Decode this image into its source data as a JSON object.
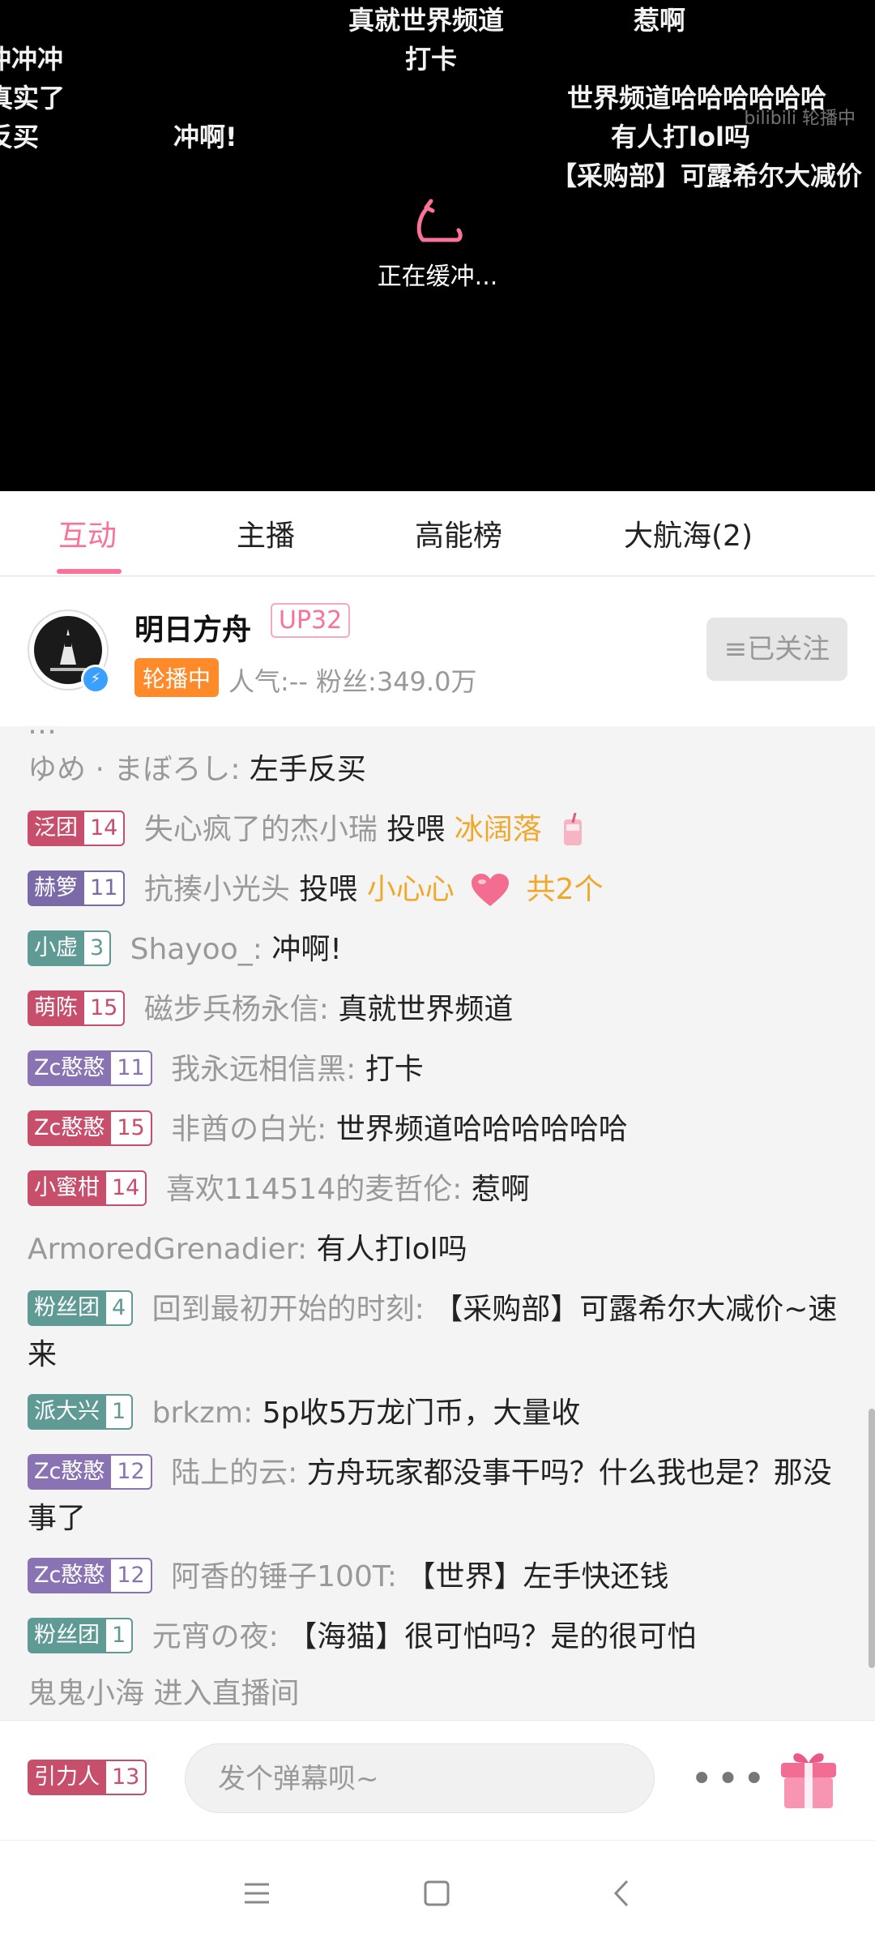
{
  "player": {
    "danmaku": [
      "真就世界频道",
      "惹啊",
      "冲冲冲",
      "打卡",
      "真实了",
      "世界频道哈哈哈哈哈哈",
      "反买",
      "冲啊!",
      "有人打lol吗",
      "【采购部】可露希尔大减价"
    ],
    "watermark": "bilibili 轮播中",
    "buffering_text": "正在缓冲..."
  },
  "tabs": [
    "互动",
    "主播",
    "高能榜",
    "大航海(2)"
  ],
  "streamer": {
    "name": "明日方舟",
    "up_level": "UP32",
    "status_badge": "轮播中",
    "stats": "人气:--  粉丝:349.0万",
    "follow_label": "≡已关注"
  },
  "chat": {
    "partial_top": "…",
    "lines": [
      {
        "user": "ゆめ · まぼろし:",
        "text": "左手反买"
      },
      {
        "medal": {
          "name": "泛团",
          "level": "14",
          "color": "#c74f6c"
        },
        "user": "失心疯了的杰小瑞",
        "action": "投喂",
        "gift": "冰阔落"
      },
      {
        "medal": {
          "name": "赫箩",
          "level": "11",
          "color": "#7a6aa8"
        },
        "user": "抗揍小光头",
        "action": "投喂",
        "gift": "小心心",
        "count": "共2个"
      },
      {
        "medal": {
          "name": "小虚",
          "level": "3",
          "color": "#5f9a95"
        },
        "user": "Shayoo_:",
        "text": "冲啊!"
      },
      {
        "medal": {
          "name": "萌陈",
          "level": "15",
          "color": "#c74f6c"
        },
        "user": "磁步兵杨永信:",
        "text": "真就世界频道"
      },
      {
        "medal": {
          "name": "Zc憨憨",
          "level": "11",
          "color": "#8a73b3"
        },
        "user": "我永远相信黑:",
        "text": "打卡"
      },
      {
        "medal": {
          "name": "Zc憨憨",
          "level": "15",
          "color": "#c74f6c"
        },
        "user": "非酋の白光:",
        "text": "世界频道哈哈哈哈哈哈"
      },
      {
        "medal": {
          "name": "小蜜柑",
          "level": "14",
          "color": "#c74f6c"
        },
        "user": "喜欢114514的麦哲伦:",
        "text": "惹啊"
      },
      {
        "user": "ArmoredGrenadier:",
        "text": "有人打lol吗"
      },
      {
        "medal": {
          "name": "粉丝团",
          "level": "4",
          "color": "#5f9a95"
        },
        "user": "回到最初开始的时刻:",
        "text": "【采购部】可露希尔大减价~速来"
      },
      {
        "medal": {
          "name": "派大兴",
          "level": "1",
          "color": "#5f9a95"
        },
        "user": "brkzm:",
        "text": "5p收5万龙门币，大量收"
      },
      {
        "medal": {
          "name": "Zc憨憨",
          "level": "12",
          "color": "#8a73b3"
        },
        "user": "陆上的云:",
        "text": "方舟玩家都没事干吗？什么我也是？那没事了"
      },
      {
        "medal": {
          "name": "Zc憨憨",
          "level": "12",
          "color": "#8a73b3"
        },
        "user": "阿香的锤子100T:",
        "text": "【世界】左手快还钱"
      },
      {
        "medal": {
          "name": "粉丝团",
          "level": "1",
          "color": "#5f9a95"
        },
        "user": "元宵の夜:",
        "text": "【海猫】很可怕吗？是的很可怕"
      },
      {
        "user": "鬼鬼小海",
        "text": "进入直播间"
      }
    ]
  },
  "input_bar": {
    "my_medal": {
      "name": "引力人",
      "level": "13",
      "color": "#c74f6c"
    },
    "placeholder": "发个弹幕呗~",
    "more_label": "•••"
  },
  "colors": {
    "accent": "#fb7299",
    "gift": "#f0a82a",
    "badge_orange": "#ff8a2a"
  },
  "icons": [
    "buffer-icon",
    "verify-icon",
    "gift-icon",
    "menu-nav-icon",
    "home-nav-icon",
    "back-nav-icon"
  ]
}
